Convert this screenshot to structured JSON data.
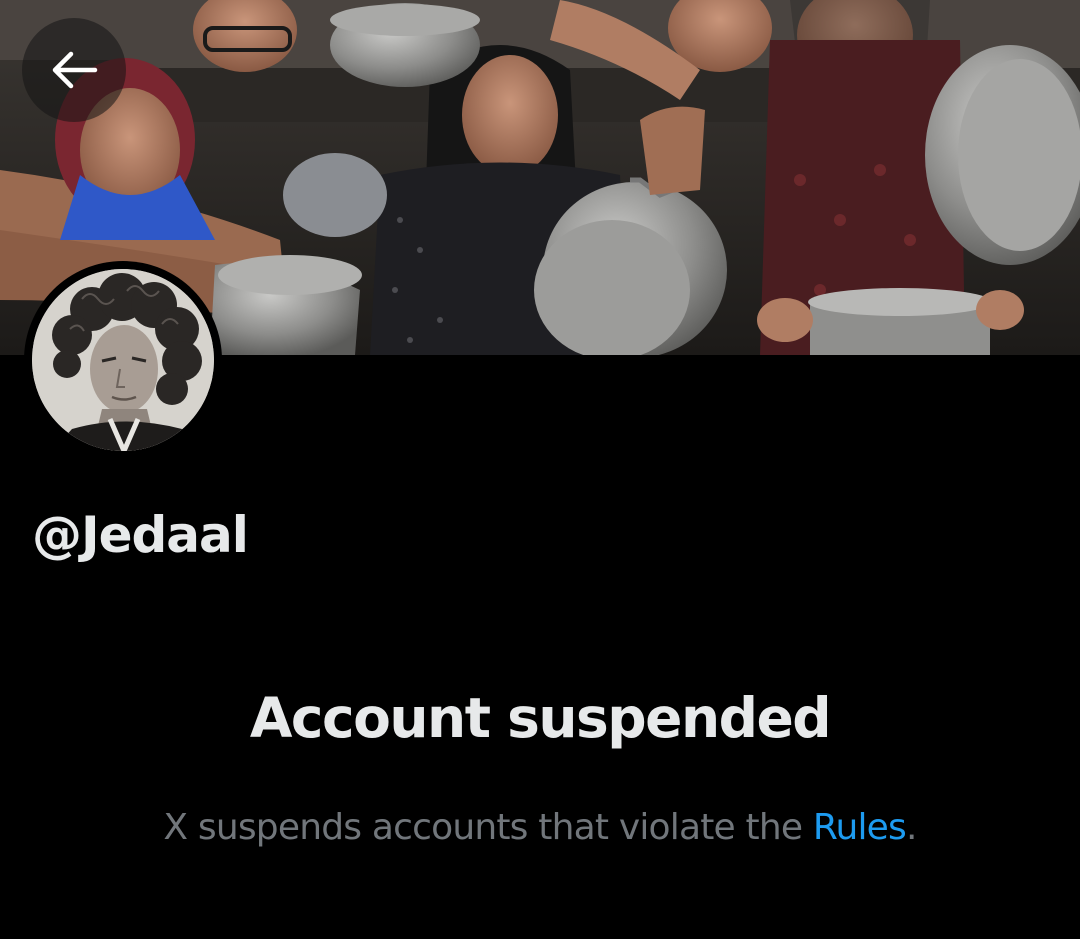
{
  "profile": {
    "handle": "@Jedaal"
  },
  "suspension": {
    "title": "Account suspended",
    "message_prefix": "X suspends accounts that violate the ",
    "rules_link": "Rules",
    "message_suffix": "."
  },
  "icons": {
    "back": "arrow-left-icon"
  },
  "colors": {
    "background": "#000000",
    "primary_text": "#e7e9ea",
    "secondary_text": "#71767b",
    "link": "#1d9bf0"
  }
}
